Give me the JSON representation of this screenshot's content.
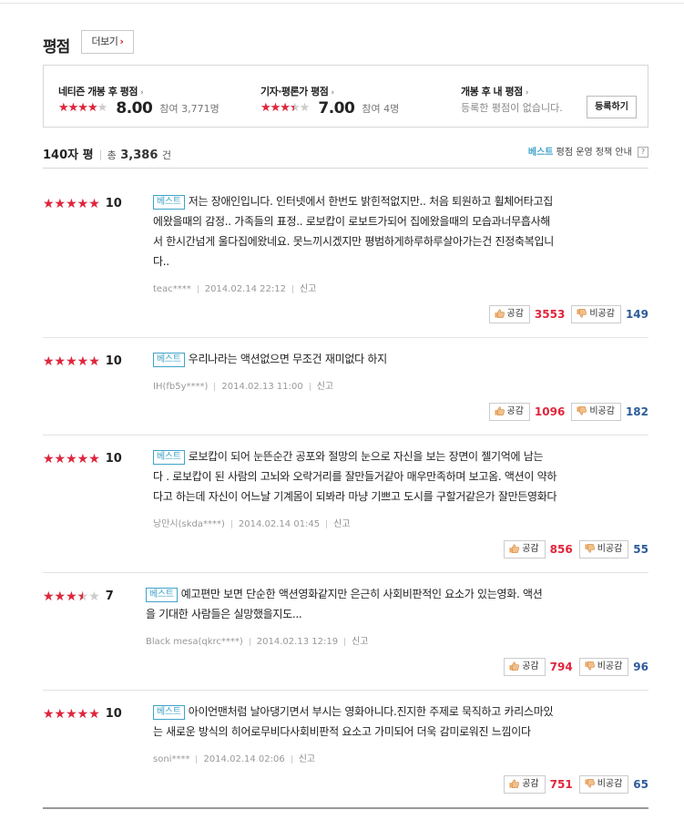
{
  "header": {
    "title": "평점",
    "more_label": "더보기"
  },
  "summary": {
    "netizen": {
      "title": "네티즌 개봉 후 평점",
      "score": "8.00",
      "participants": "참여 3,771명",
      "stars_fraction": 0.8
    },
    "critic": {
      "title": "기자·평론가 평점",
      "score": "7.00",
      "participants": "참여 4명",
      "stars_fraction": 0.7
    },
    "mine": {
      "title": "개봉 후 내 평점",
      "empty_text": "등록한 평점이 없습니다.",
      "button_label": "등록하기"
    }
  },
  "list_header": {
    "label": "140자 평",
    "total_prefix": "총",
    "total_count": "3,386",
    "total_suffix": "건",
    "policy_best": "베스트",
    "policy_text": "평점 운영 정책 안내",
    "help": "?"
  },
  "reviews": [
    {
      "score": "10",
      "stars_fraction": 1.0,
      "badge": "베스트",
      "lines": [
        "저는 장애인입니다. 인터넷에서 한번도 밝힌적없지만.. 처음 퇴원하고 휠체어타고집",
        "에왔을때의 감정.. 가족들의 표정.. 로보캅이 로보트가되어 집에왔을때의 모습과너무흡사해",
        "서 한시간넘게 울다집에왔네요. 못느끼시겠지만 평범하게하루하루살아가는건 진정축복입니",
        "다.."
      ],
      "user": "teac****",
      "date": "2014.02.14 22:12",
      "report": "신고",
      "like_label": "공감",
      "likes": "3553",
      "dislike_label": "비공감",
      "dislikes": "149"
    },
    {
      "score": "10",
      "stars_fraction": 1.0,
      "badge": "베스트",
      "lines": [
        "우리나라는 액션없으면 무조건 재미없다 하지"
      ],
      "user": "IH(fb5y****)",
      "date": "2014.02.13 11:00",
      "report": "신고",
      "like_label": "공감",
      "likes": "1096",
      "dislike_label": "비공감",
      "dislikes": "182"
    },
    {
      "score": "10",
      "stars_fraction": 1.0,
      "badge": "베스트",
      "lines": [
        "로보캅이 되어 눈뜬순간 공포와 절망의 눈으로 자신을 보는 장면이 젤기억에 남는",
        "다 . 로보캅이 된 사람의 고뇌와 오락거리를 잘만들거같아 매우만족하며 보고옴. 액션이 약하",
        "다고 하는데 자신이 어느날 기계몸이 되봐라 마냥 기쁘고 도시를 구할거같은가 잘만든영화다"
      ],
      "user": "낭만시(skda****)",
      "date": "2014.02.14 01:45",
      "report": "신고",
      "like_label": "공감",
      "likes": "856",
      "dislike_label": "비공감",
      "dislikes": "55"
    },
    {
      "score": "7",
      "stars_fraction": 0.7,
      "badge": "베스트",
      "lines": [
        "예고편만 보면 단순한 액션영화같지만 은근히 사회비판적인 요소가 있는영화. 액션",
        "을 기대한 사람들은 실망했을지도..."
      ],
      "user": "Black mesa(qkrc****)",
      "date": "2014.02.13 12:19",
      "report": "신고",
      "like_label": "공감",
      "likes": "794",
      "dislike_label": "비공감",
      "dislikes": "96"
    },
    {
      "score": "10",
      "stars_fraction": 1.0,
      "badge": "베스트",
      "lines": [
        "아이언맨처럼 날아댕기면서 부시는 영화아니다.진지한 주제로 묵직하고 카리스마있",
        "는 새로운 방식의 히어로무비다사회비판적 요소고 가미되어 더욱 감미로워진 느낌이다"
      ],
      "user": "soni****",
      "date": "2014.02.14 02:06",
      "report": "신고",
      "like_label": "공감",
      "likes": "751",
      "dislike_label": "비공감",
      "dislikes": "65"
    }
  ],
  "colors": {
    "star": "#e1253c",
    "best": "#3fa3c8",
    "likes": "#e1253c",
    "dislikes": "#2d5b9a"
  }
}
